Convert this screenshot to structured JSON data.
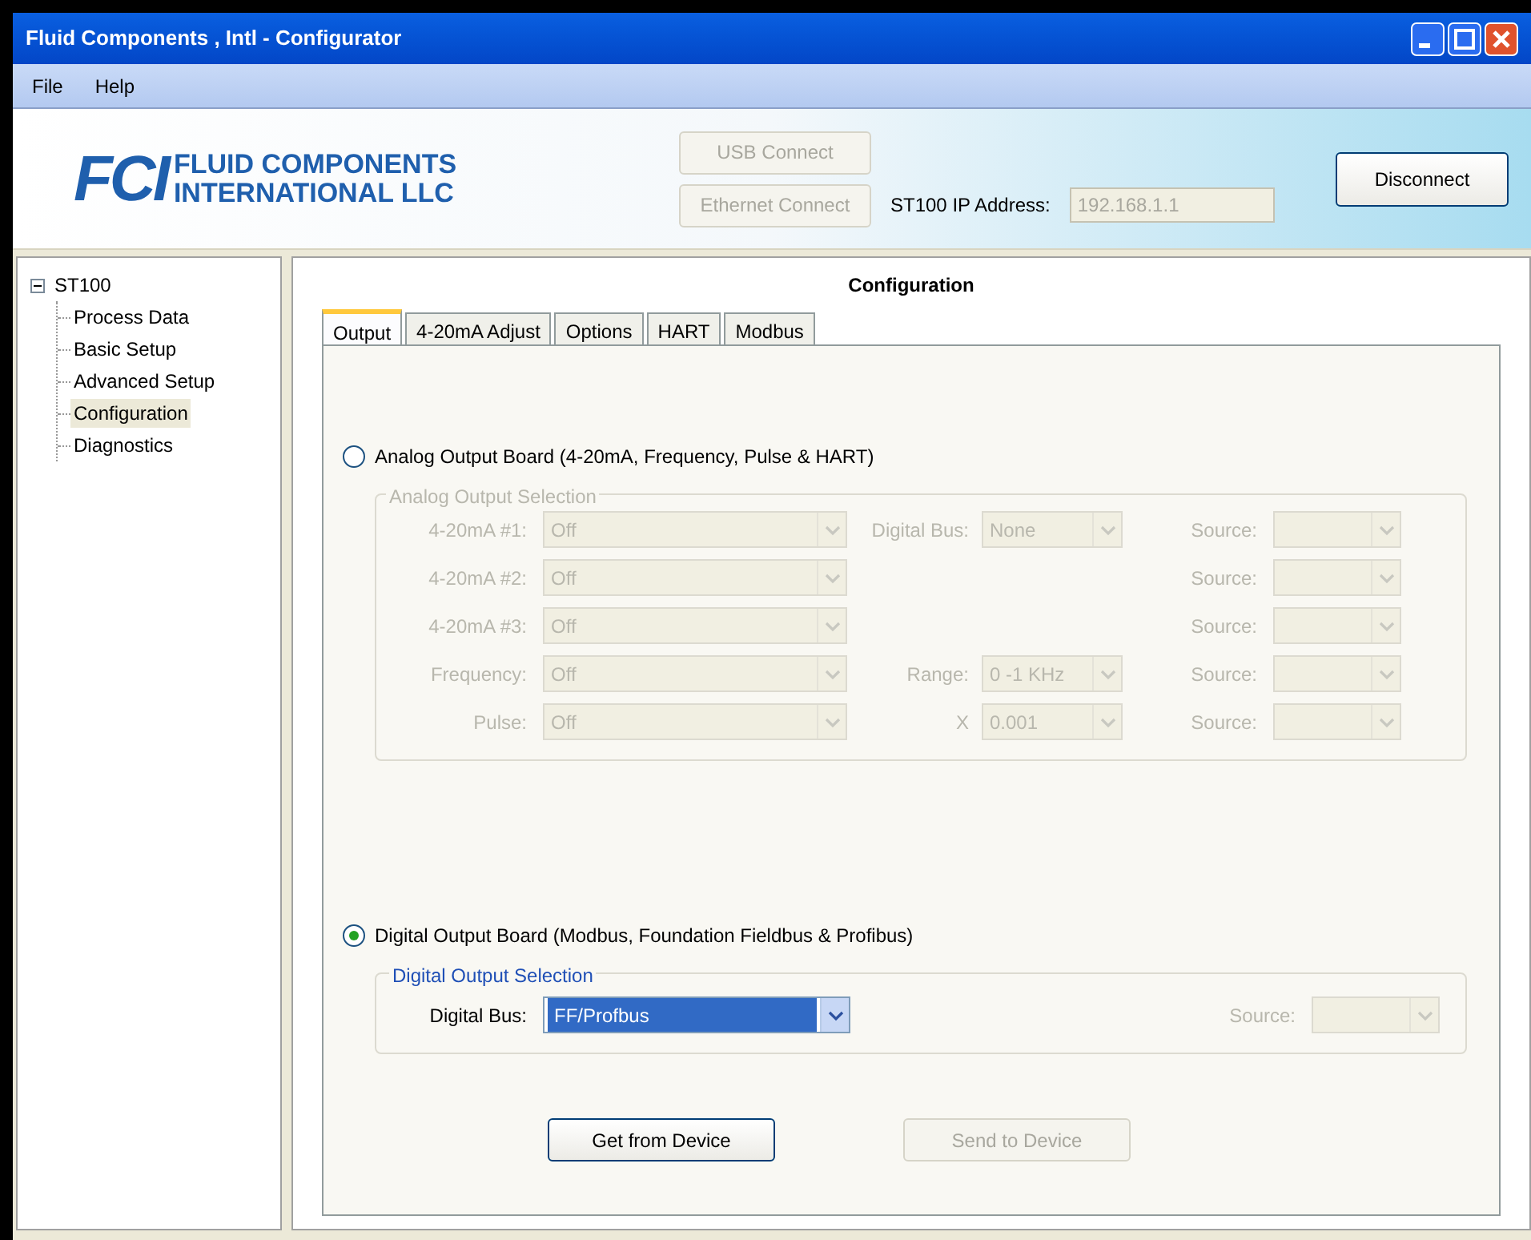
{
  "window": {
    "title": "Fluid Components , Intl - Configurator"
  },
  "menu": [
    "File",
    "Help"
  ],
  "banner": {
    "logo_mark": "FCI",
    "logo_lines": [
      "FLUID COMPONENTS",
      "INTERNATIONAL LLC"
    ],
    "usb_button": {
      "label": "USB Connect",
      "disabled": true
    },
    "ethernet_button": {
      "label": "Ethernet Connect",
      "disabled": true
    },
    "ip_label": "ST100 IP Address:",
    "ip_value": "192.168.1.1",
    "disconnect_button": {
      "label": "Disconnect",
      "disabled": false
    }
  },
  "tree": {
    "label": "ST100",
    "expanded": true,
    "children": [
      {
        "label": "Process Data",
        "selected": false
      },
      {
        "label": "Basic Setup",
        "selected": false
      },
      {
        "label": "Advanced Setup",
        "selected": false
      },
      {
        "label": "Configuration",
        "selected": true
      },
      {
        "label": "Diagnostics",
        "selected": false
      }
    ]
  },
  "heading": "Configuration",
  "tabs": [
    {
      "label": "Output",
      "selected": true
    },
    {
      "label": "4-20mA Adjust",
      "selected": false
    },
    {
      "label": "Options",
      "selected": false
    },
    {
      "label": "HART",
      "selected": false
    },
    {
      "label": "Modbus",
      "selected": false
    }
  ],
  "analog": {
    "label": "Analog Output Board (4-20mA, Frequency, Pulse & HART)",
    "selected": false,
    "group": "Analog Output Selection",
    "disabled": true,
    "rows": [
      {
        "label": "4-20mA #1:",
        "value": "Off",
        "middle": {
          "label": "Digital Bus:",
          "value": "None"
        },
        "source": "Source:"
      },
      {
        "label": "4-20mA #2:",
        "value": "Off",
        "source": "Source:"
      },
      {
        "label": "4-20mA #3:",
        "value": "Off",
        "source": "Source:"
      },
      {
        "label": "Frequency:",
        "value": "Off",
        "middle": {
          "label": "Range:",
          "value": "0 -1 KHz"
        },
        "source": "Source:"
      },
      {
        "label": "Pulse:",
        "value": "Off",
        "middle": {
          "label": "X",
          "value": "0.001"
        },
        "source": "Source:"
      }
    ]
  },
  "digital": {
    "label": "Digital Output Board (Modbus, Foundation Fieldbus & Profibus)",
    "selected": true,
    "group": "Digital Output Selection",
    "bus_label": "Digital Bus:",
    "bus_value": "FF/Profbus",
    "bus_focused": true,
    "source": "Source:",
    "source_disabled": true
  },
  "actions": [
    {
      "label": "Get from Device",
      "disabled": false
    },
    {
      "label": "Send to Device",
      "disabled": true
    }
  ]
}
